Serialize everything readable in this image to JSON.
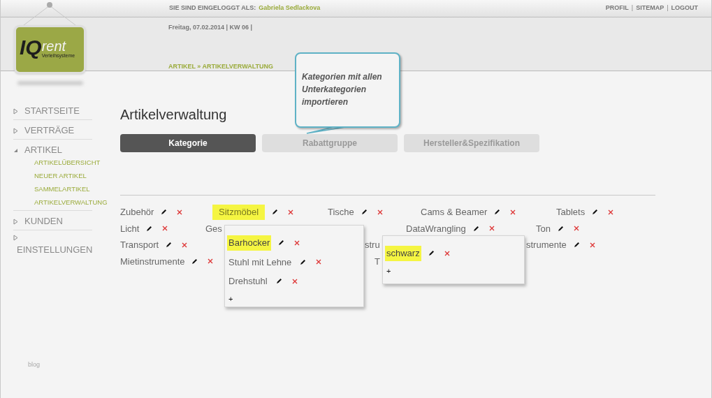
{
  "header": {
    "login_label": "SIE SIND EINGELOGGT ALS:",
    "user": "Gabriela Sedlackova",
    "links": [
      {
        "kind": "link",
        "label": "PROFIL"
      },
      {
        "kind": "separator",
        "label": "|"
      },
      {
        "kind": "link",
        "label": "SITEMAP"
      },
      {
        "kind": "separator",
        "label": "|"
      },
      {
        "kind": "link",
        "label": "LOGOUT"
      }
    ],
    "date": "Freitag, 07.02.2014 | KW 06 |",
    "breadcrumb": "ARTIKEL » ARTIKELVERWALTUNG"
  },
  "logo": {
    "brand": "IQ",
    "word": "rent",
    "tagline": "Verleihsysteme"
  },
  "sidebar": {
    "items": [
      {
        "label": "STARTSEITE",
        "expanded": false
      },
      {
        "label": "VERTRÄGE",
        "expanded": false
      },
      {
        "label": "ARTIKEL",
        "expanded": true,
        "children": [
          {
            "label": "ARTIKELÜBERSICHT"
          },
          {
            "label": "NEUER ARTIKEL"
          },
          {
            "label": "SAMMELARTIKEL"
          },
          {
            "label": "ARTIKELVERWALTUNG"
          }
        ]
      },
      {
        "label": "KUNDEN",
        "expanded": false
      },
      {
        "label": "EINSTELLUNGEN",
        "expanded": false
      }
    ],
    "footer": "blog"
  },
  "page_title": "Artikelverwaltung",
  "tabs": [
    {
      "label": "Kategorie",
      "selected": true
    },
    {
      "label": "Rabattgruppe",
      "selected": false
    },
    {
      "label": "Hersteller&Spezifikation",
      "selected": false
    }
  ],
  "callout": "Kategorien mit allen Unterkategorien importieren",
  "categories": [
    [
      {
        "label": "Zubehör",
        "highlighted": false,
        "actions": true
      },
      {
        "label": "Sitzmöbel",
        "highlighted": true,
        "actions": true
      },
      {
        "label": "Tische",
        "highlighted": false,
        "actions": true
      },
      {
        "label": "Cams & Beamer",
        "highlighted": false,
        "actions": true
      },
      {
        "label": "Tablets",
        "highlighted": false,
        "actions": true
      }
    ],
    [
      {
        "label": "Licht",
        "highlighted": false,
        "actions": true
      },
      {
        "label": "Ges",
        "highlighted": false
      },
      {
        "label": "DataWrangling",
        "highlighted": false,
        "actions": true
      },
      {
        "label": "Ton",
        "highlighted": false,
        "actions": true
      }
    ],
    [
      {
        "label": "Transport",
        "highlighted": false,
        "actions": true
      },
      {
        "label": "stru",
        "highlighted": false
      },
      {
        "label": "strumente",
        "highlighted": false,
        "actions": true
      }
    ],
    [
      {
        "label": "Mietinstrumente",
        "highlighted": false,
        "actions": true
      },
      {
        "label": "T",
        "highlighted": false
      }
    ]
  ],
  "popups": [
    {
      "items": [
        {
          "label": "Barhocker",
          "highlighted": true
        },
        {
          "label": "Stuhl mit Lehne",
          "highlighted": false
        },
        {
          "label": "Drehstuhl",
          "highlighted": false
        }
      ],
      "add": "+"
    },
    {
      "items": [
        {
          "label": "schwarz",
          "highlighted": true
        }
      ],
      "add": "+"
    }
  ]
}
